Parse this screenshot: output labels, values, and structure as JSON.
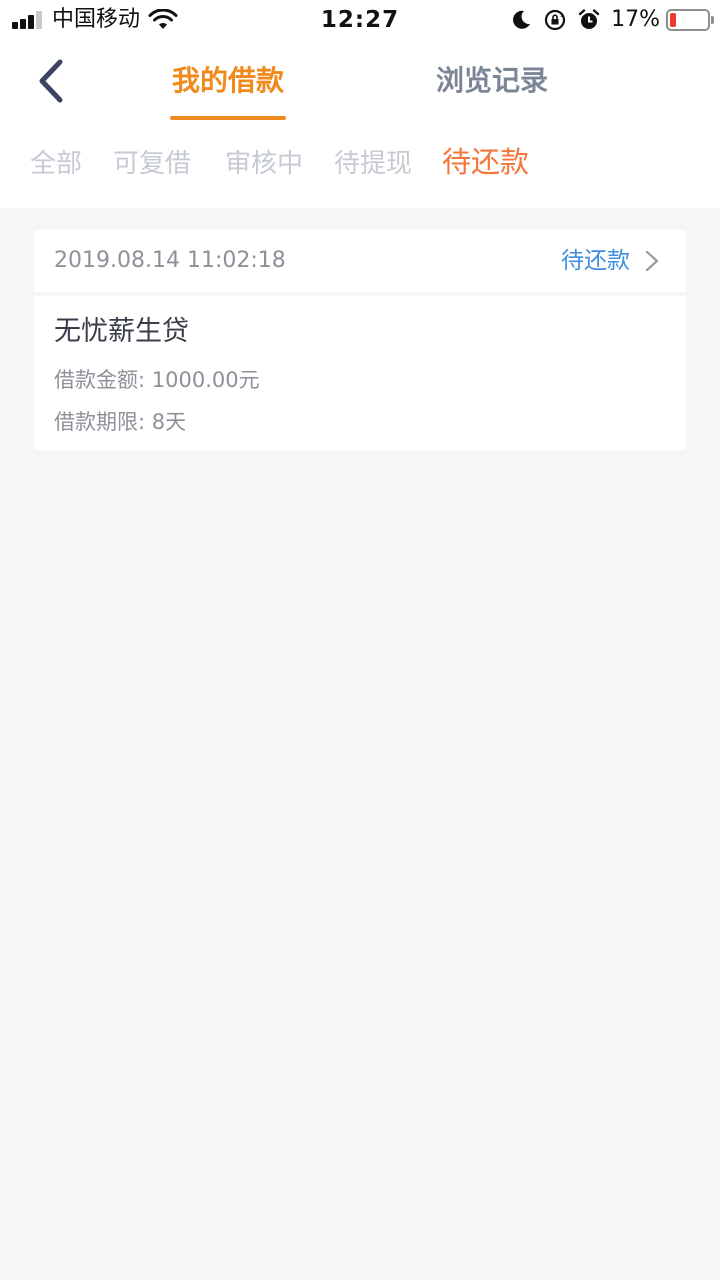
{
  "status_bar": {
    "carrier": "中国移动",
    "time": "12:27",
    "battery_percent": "17%",
    "battery_level": 0.17,
    "icons": [
      "signal-icon",
      "wifi-icon",
      "moon-icon",
      "rotation-lock-icon",
      "alarm-icon",
      "battery-icon"
    ]
  },
  "header": {
    "back_icon": "chevron-left-icon",
    "tabs": [
      {
        "label": "我的借款",
        "active": true
      },
      {
        "label": "浏览记录",
        "active": false
      }
    ]
  },
  "filters": {
    "items": [
      "全部",
      "可复借",
      "审核中",
      "待提现",
      "待还款"
    ],
    "selected": "待还款"
  },
  "loans": [
    {
      "datetime": "2019.08.14 11:02:18",
      "status": "待还款",
      "product": "无忧薪生贷",
      "amount_label": "借款金额:",
      "amount_value": "1000.00元",
      "term_label": "借款期限:",
      "term_value": "8天"
    }
  ],
  "colors": {
    "accent_orange": "#f08a1c",
    "filter_active": "#f5763a",
    "status_blue": "#3f8ee0",
    "background": "#f5f6f8"
  }
}
